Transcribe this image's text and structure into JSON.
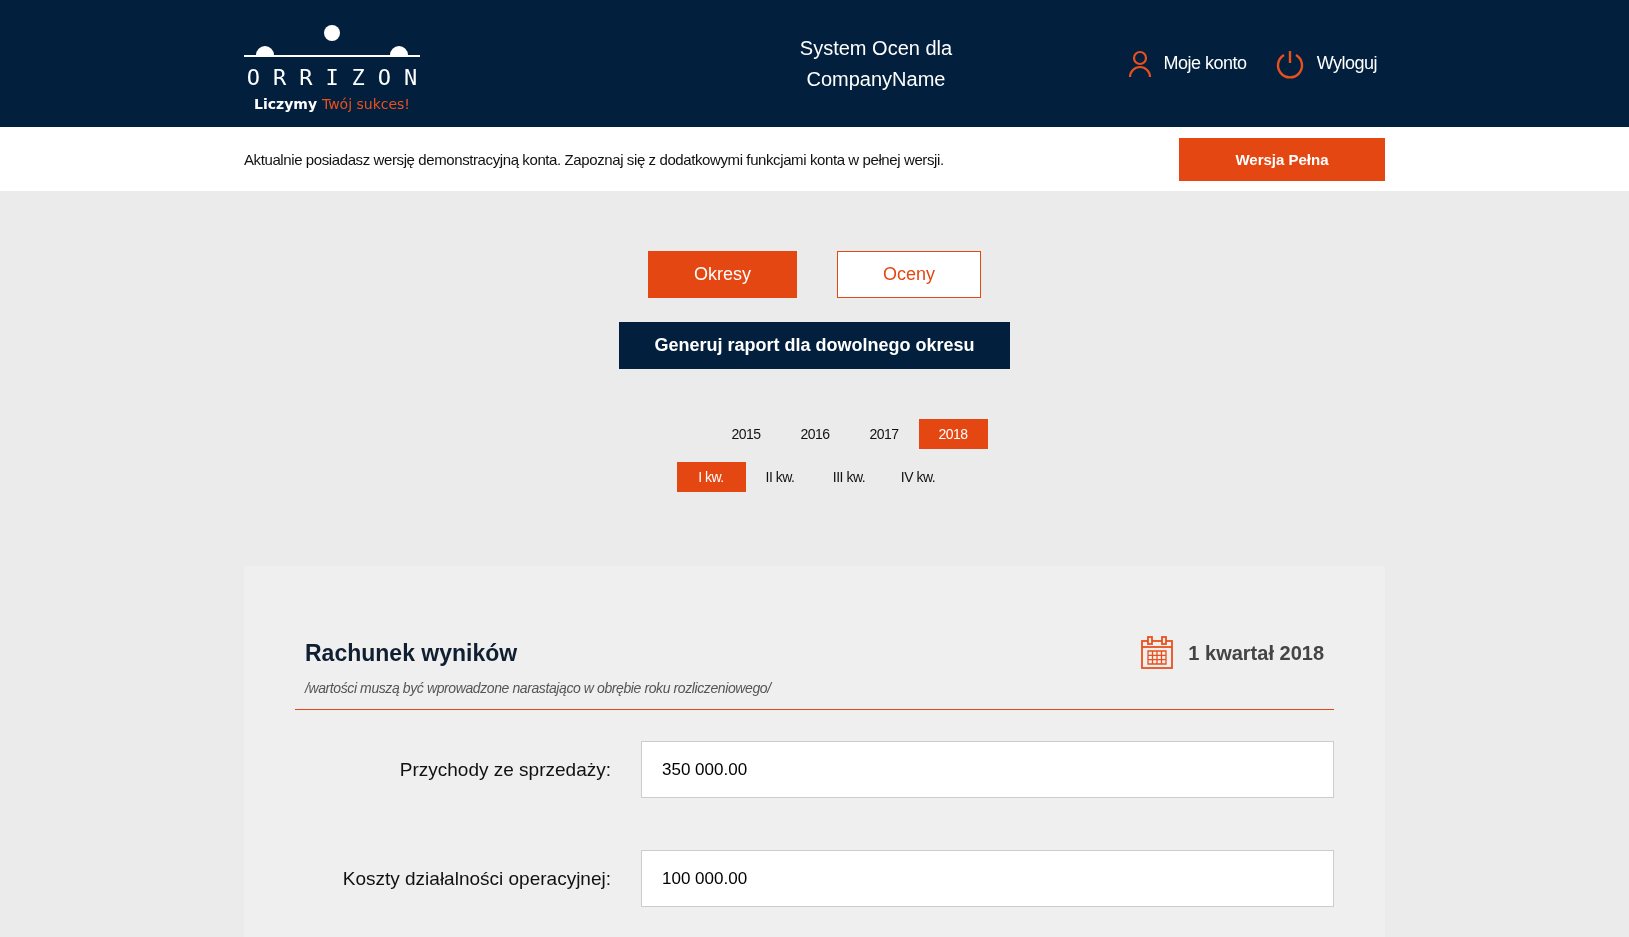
{
  "header": {
    "logo_text": "ORRIZON",
    "tagline_lead": "Liczymy",
    "tagline_accent": "Twój sukces!",
    "title": "System Ocen dla CompanyName",
    "account": "Moje konto",
    "logout": "Wyloguj"
  },
  "banner": {
    "text": "Aktualnie posiadasz wersję demonstracyjną konta. Zapoznaj się z dodatkowymi funkcjami konta w pełnej wersji.",
    "button": "Wersja Pełna"
  },
  "tabs": [
    {
      "label": "Okresy",
      "selected": true
    },
    {
      "label": "Oceny",
      "selected": false
    }
  ],
  "report_button": "Generuj raport dla dowolnego okresu",
  "years": [
    {
      "label": "2015",
      "selected": false
    },
    {
      "label": "2016",
      "selected": false
    },
    {
      "label": "2017",
      "selected": false
    },
    {
      "label": "2018",
      "selected": true
    }
  ],
  "quarters": [
    {
      "label": "I kw.",
      "selected": true
    },
    {
      "label": "II kw.",
      "selected": false
    },
    {
      "label": "III kw.",
      "selected": false
    },
    {
      "label": "IV kw.",
      "selected": false
    }
  ],
  "card": {
    "title": "Rachunek wyników",
    "period": "1 kwartał 2018",
    "note": "/wartości muszą być wprowadzone narastająco w obrębie roku rozliczeniowego/",
    "fields": [
      {
        "label": "Przychody ze sprzedaży:",
        "value": "350 000.00"
      },
      {
        "label": "Koszty działalności operacyjnej:",
        "value": "100 000.00"
      }
    ]
  }
}
